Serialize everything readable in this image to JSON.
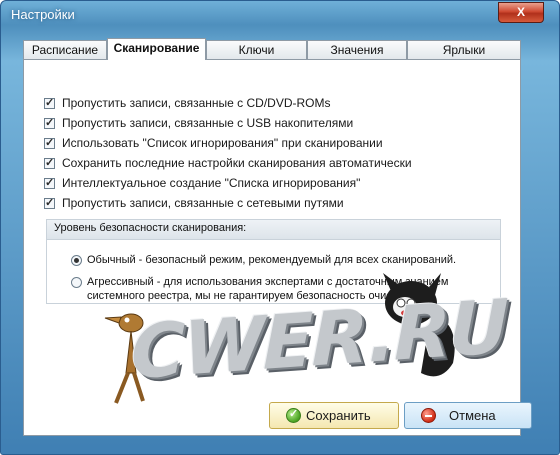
{
  "window": {
    "title": "Настройки",
    "close_label": "X"
  },
  "tabs": [
    {
      "label": "Расписание",
      "active": false
    },
    {
      "label": "Сканирование",
      "active": true
    },
    {
      "label": "Ключи",
      "active": false
    },
    {
      "label": "Значения",
      "active": false
    },
    {
      "label": "Ярлыки",
      "active": false
    }
  ],
  "options": [
    {
      "label": "Пропустить записи, связанные с CD/DVD-ROMs",
      "checked": true
    },
    {
      "label": "Пропустить записи, связанные с USB накопителями",
      "checked": true
    },
    {
      "label": "Использовать \"Список игнорирования\" при сканировании",
      "checked": true
    },
    {
      "label": "Сохранить последние настройки сканирования автоматически",
      "checked": true
    },
    {
      "label": "Интеллектуальное создание \"Списка игнорирования\"",
      "checked": true
    },
    {
      "label": "Пропустить записи, связанные с сетевыми путями",
      "checked": true
    }
  ],
  "security": {
    "title": "Уровень безопасности сканирования:",
    "normal": {
      "text": "Обычный - безопасный режим, рекомендуемый для всех сканирований.",
      "selected": true
    },
    "aggressive": {
      "line1": "Агрессивный - для использования экспертами с достаточным знанием",
      "line2": "системного реестра, мы не гарантируем безопасность очистки.",
      "selected": false
    }
  },
  "buttons": {
    "save": "Сохранить",
    "cancel": "Отмена"
  },
  "watermark": {
    "text": "CWER.RU"
  },
  "colors": {
    "titlebar": "#4e8fbd",
    "close": "#cf4a32",
    "save_bg": "#f4e7b0",
    "cancel_bg": "#c9e3f6"
  }
}
